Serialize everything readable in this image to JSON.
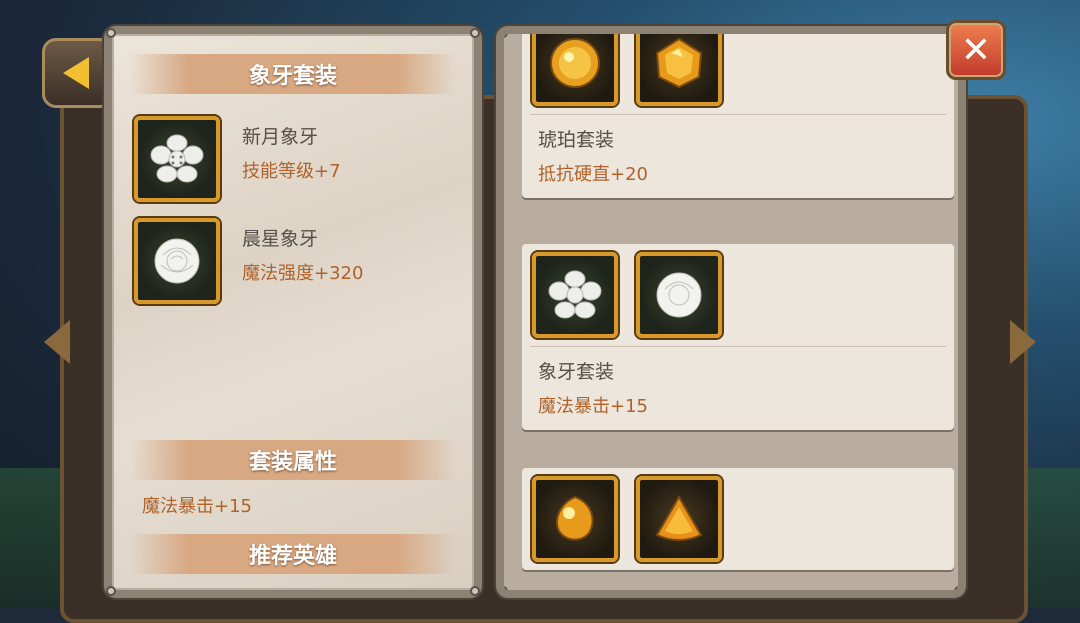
{
  "left_panel": {
    "title": "象牙套装",
    "items": [
      {
        "name": "新月象牙",
        "stat": "技能等级+7",
        "icon": "crescent-ivory-icon"
      },
      {
        "name": "晨星象牙",
        "stat": "魔法强度+320",
        "icon": "morning-star-ivory-icon"
      }
    ],
    "set_attr_title": "套装属性",
    "set_attr_value": "魔法暴击+15",
    "recommend_title": "推荐英雄"
  },
  "right_panel": {
    "sets": [
      {
        "name": "琥珀套装",
        "stat": "抵抗硬直+20",
        "icons": [
          "amber-round-gem-icon",
          "amber-faceted-gem-icon"
        ]
      },
      {
        "name": "象牙套装",
        "stat": "魔法暴击+15",
        "icons": [
          "crescent-ivory-icon",
          "morning-star-ivory-icon"
        ]
      },
      {
        "name": "",
        "stat": "",
        "icons": [
          "amber-drop-gem-icon",
          "amber-triangle-gem-icon"
        ]
      }
    ]
  },
  "header_fragment": "5",
  "colors": {
    "stat": "#b0622a",
    "name": "#555049",
    "icon_border": "#d79a2a",
    "close": "#e0553a"
  }
}
